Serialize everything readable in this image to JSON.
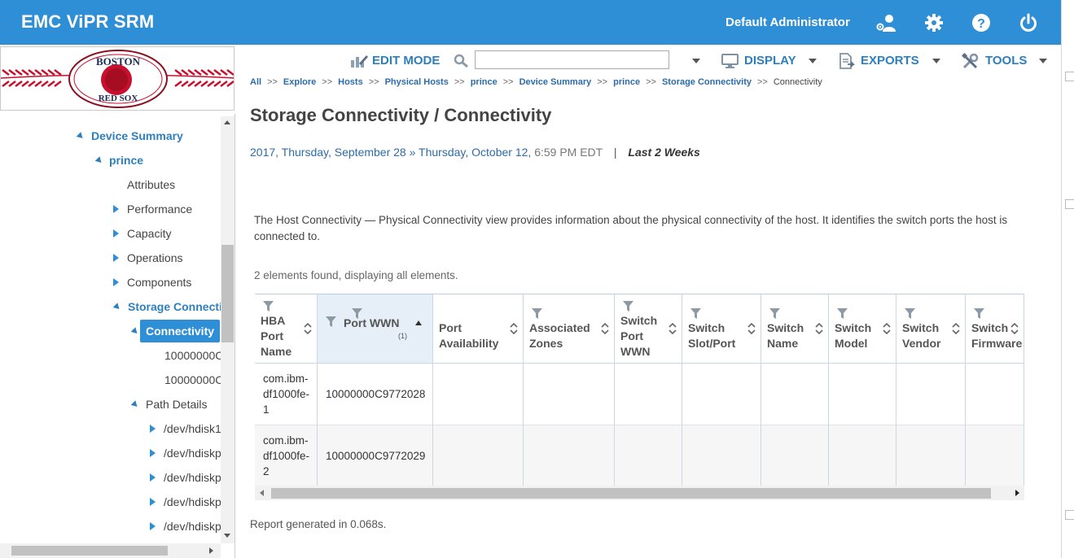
{
  "header": {
    "app_title": "EMC ViPR SRM",
    "user_name": "Default Administrator",
    "icons": [
      "users-icon",
      "gear-icon",
      "help-icon",
      "power-icon"
    ]
  },
  "logo": {
    "text_top": "BOSTON",
    "text_bottom": "RED SOX"
  },
  "toolbar": {
    "edit_mode": "EDIT MODE",
    "search_value": "",
    "display": "DISPLAY",
    "exports": "EXPORTS",
    "tools": "TOOLS"
  },
  "breadcrumb": [
    "All",
    "Explore",
    "Hosts",
    "Physical Hosts",
    "prince",
    "Device Summary",
    "prince",
    "Storage Connectivity",
    "Connectivity"
  ],
  "breadcrumb_sep": ">>",
  "sidebar": {
    "items": [
      {
        "label": "Device Summary",
        "level": 0
      },
      {
        "label": "prince",
        "level": 1
      },
      {
        "label": "Attributes",
        "level": 2
      },
      {
        "label": "Performance",
        "level": 2
      },
      {
        "label": "Capacity",
        "level": 2
      },
      {
        "label": "Operations",
        "level": 2
      },
      {
        "label": "Components",
        "level": 2
      },
      {
        "label": "Storage Connecti",
        "level": 2
      },
      {
        "label": "Connectivity",
        "level": 3
      },
      {
        "label": "10000000C",
        "level": 4
      },
      {
        "label": "10000000C",
        "level": 4
      },
      {
        "label": "Path Details",
        "level": 3
      },
      {
        "label": "/dev/hdisk1",
        "level": 4
      },
      {
        "label": "/dev/hdiskp",
        "level": 4
      },
      {
        "label": "/dev/hdiskp",
        "level": 4
      },
      {
        "label": "/dev/hdiskp",
        "level": 4
      },
      {
        "label": "/dev/hdiskp",
        "level": 4
      }
    ]
  },
  "page": {
    "title": "Storage Connectivity / Connectivity",
    "date_start": "2017, Thursday, September 28",
    "date_arrow": "»",
    "date_end": "Thursday, October 12,",
    "time": "6:59 PM EDT",
    "divider": "|",
    "period": "Last 2 Weeks",
    "description": "The Host Connectivity — Physical Connectivity view provides information about the physical connectivity of the host. It identifies the switch ports the host is connected to.",
    "count": "2 elements found, displaying all elements.",
    "report": "Report generated in 0.068s."
  },
  "table": {
    "columns": [
      {
        "label": [
          "HBA",
          "Port",
          "Name"
        ]
      },
      {
        "label": [
          "Port WWN"
        ],
        "sort_index": "(1)",
        "sorted": "asc"
      },
      {
        "label": [
          "Port",
          "Availability"
        ]
      },
      {
        "label": [
          "Associated",
          "Zones"
        ]
      },
      {
        "label": [
          "Switch",
          "Port",
          "WWN"
        ]
      },
      {
        "label": [
          "Switch",
          "Slot/Port"
        ]
      },
      {
        "label": [
          "Switch",
          "Name"
        ]
      },
      {
        "label": [
          "Switch",
          "Model"
        ]
      },
      {
        "label": [
          "Switch",
          "Vendor"
        ]
      },
      {
        "label": [
          "Switch",
          "Firmware"
        ]
      }
    ],
    "rows": [
      {
        "hba": [
          "com.ibm-",
          "df1000fe-",
          "1"
        ],
        "wwn": "10000000C9772028"
      },
      {
        "hba": [
          "com.ibm-",
          "df1000fe-",
          "2"
        ],
        "wwn": "10000000C9772029"
      }
    ]
  }
}
